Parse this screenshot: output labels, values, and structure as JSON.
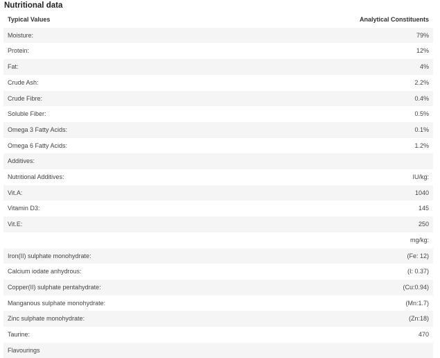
{
  "section": {
    "title": "Nutritional data"
  },
  "table": {
    "header_left": "Typical Values",
    "header_right": "Analytical Constituents",
    "rows": [
      {
        "label": "Moisture:",
        "value": "79%"
      },
      {
        "label": "Protein:",
        "value": "12%"
      },
      {
        "label": "Fat:",
        "value": "4%"
      },
      {
        "label": "Crude Ash:",
        "value": "2.2%"
      },
      {
        "label": "Crude Fibre:",
        "value": "0.4%"
      },
      {
        "label": "Soluble Fiber:",
        "value": "0.5%"
      },
      {
        "label": "Omega 3 Fatty Acids:",
        "value": "0.1%"
      },
      {
        "label": "Omega 6 Fatty Acids:",
        "value": "1.2%"
      },
      {
        "label": "Additives:",
        "value": ""
      },
      {
        "label": "Nutritional Additives:",
        "value": "IU/kg:"
      },
      {
        "label": "Vit.A:",
        "value": "1040"
      },
      {
        "label": "Vitamin D3:",
        "value": "145"
      },
      {
        "label": "Vit.E:",
        "value": "250"
      },
      {
        "label": "",
        "value": "mg/kg:"
      },
      {
        "label": "Iron(II) sulphate monohydrate:",
        "value": "(Fe: 12)"
      },
      {
        "label": "Calcium iodate anhydrous:",
        "value": "(I: 0.37)"
      },
      {
        "label": "Copper(II) sulphate pentahydrate:",
        "value": "(Cu:0.94)"
      },
      {
        "label": "Manganous sulphate monohydrate:",
        "value": "(Mn:1.7)"
      },
      {
        "label": "Zinc sulphate monohydrate:",
        "value": "(Zn:18)"
      },
      {
        "label": "Taurine:",
        "value": "470"
      },
      {
        "label": "Flavourings",
        "value": ""
      }
    ]
  }
}
